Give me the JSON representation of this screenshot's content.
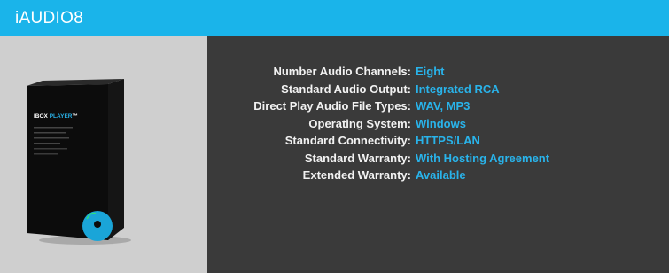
{
  "header": {
    "title": "iAUDIO8"
  },
  "product_box": {
    "brand_text": "IBOX PLAYER",
    "icon": "product-box-image"
  },
  "specs": [
    {
      "label": "Number Audio Channels:",
      "value": "Eight"
    },
    {
      "label": "Standard Audio Output:",
      "value": "Integrated RCA"
    },
    {
      "label": "Direct Play Audio File Types:",
      "value": "WAV, MP3"
    },
    {
      "label": "Operating System:",
      "value": "Windows"
    },
    {
      "label": "Standard Connectivity:",
      "value": "HTTPS/LAN"
    },
    {
      "label": "Standard Warranty:",
      "value": "With Hosting Agreement"
    },
    {
      "label": "Extended Warranty:",
      "value": "Available"
    }
  ],
  "colors": {
    "header": "#1ab4ea",
    "value_text": "#29b3ea",
    "info_background": "#3a3a3a",
    "image_background": "#cfcfcf"
  }
}
